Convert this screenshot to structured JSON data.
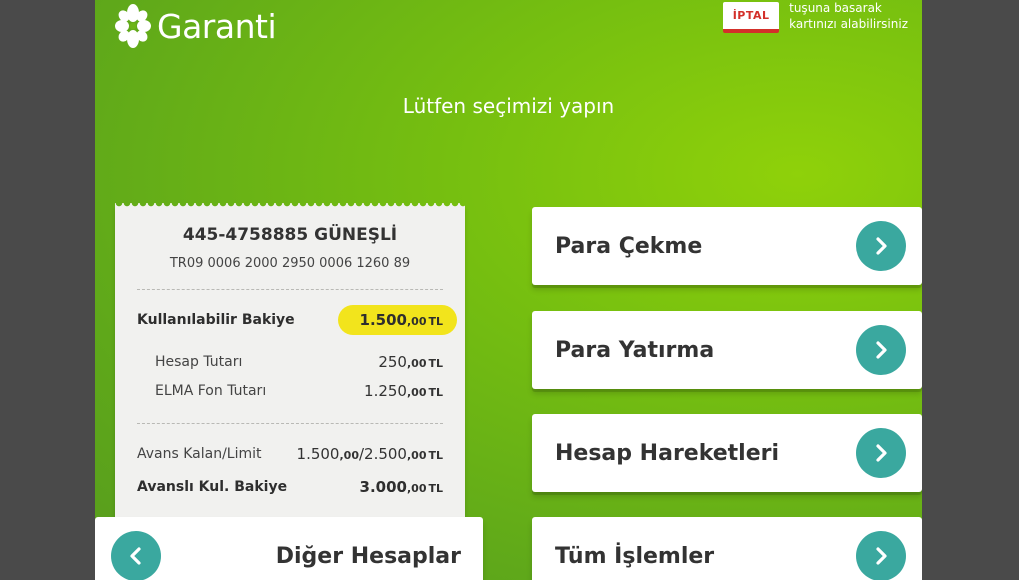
{
  "brand": {
    "name": "Garanti"
  },
  "cancel": {
    "button_label": "İPTAL",
    "hint_line1": "tuşuna basarak",
    "hint_line2": "kartınızı alabilirsiniz"
  },
  "prompt": "Lütfen seçimizi yapın",
  "account": {
    "title": "445-4758885 GÜNEŞLİ",
    "iban": "TR09 0006 2000 2950 0006 1260 89",
    "rows": [
      {
        "label": "Kullanılabilir Bakiye",
        "main": "1.500",
        "fraction": ",00",
        "unit": "TL"
      },
      {
        "label": "Hesap Tutarı",
        "main": "250",
        "fraction": ",00",
        "unit": "TL"
      },
      {
        "label": "ELMA Fon Tutarı",
        "main": "1.250",
        "fraction": ",00",
        "unit": "TL"
      },
      {
        "label": "Avans Kalan/Limit",
        "main": "1.500",
        "fraction": ",00",
        "main2": "/2.500",
        "fraction2": ",00",
        "unit": "TL"
      },
      {
        "label": "Avanslı Kul. Bakiye",
        "main": "3.000",
        "fraction": ",00",
        "unit": "TL"
      }
    ]
  },
  "menu": [
    {
      "label": "Para Çekme"
    },
    {
      "label": "Para Yatırma"
    },
    {
      "label": "Hesap Hareketleri"
    },
    {
      "label": "Tüm İşlemler"
    }
  ],
  "other_accounts": {
    "label": "Diğer Hesaplar"
  },
  "colors": {
    "screen_green": "#76bf10",
    "accent_teal": "#3aa89f",
    "highlight_yellow": "#f2e41c",
    "cancel_red": "#d3302a"
  },
  "icons": [
    "garanti-clover-icon",
    "chevron-right-icon",
    "chevron-left-icon"
  ]
}
